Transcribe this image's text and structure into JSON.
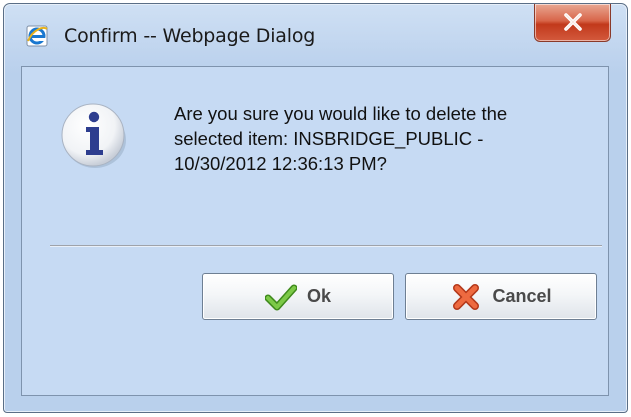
{
  "window": {
    "title": "Confirm -- Webpage Dialog",
    "title_icon": "ie-icon",
    "close_icon": "close-icon"
  },
  "message": {
    "icon": "info-icon",
    "lines": [
      "Are you sure you would like to delete the",
      "selected item: INSBRIDGE_PUBLIC -",
      "10/30/2012 12:36:13 PM?"
    ]
  },
  "buttons": {
    "ok_label": "Ok",
    "ok_icon": "checkmark-icon",
    "cancel_label": "Cancel",
    "cancel_icon": "x-icon"
  },
  "colors": {
    "close_button": "#c9482a",
    "dialog_background": "#c6daf3",
    "ok_icon": "#5aa82a",
    "cancel_icon": "#e0532f",
    "info_icon": "#2d3d8f"
  }
}
